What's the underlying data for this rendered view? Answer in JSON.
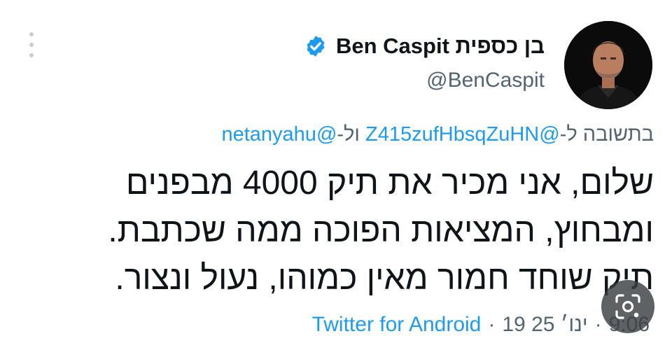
{
  "author": {
    "display_name": "Ben Caspit בן כספית",
    "handle": "@BenCaspit",
    "verified": true
  },
  "reply": {
    "prefix": "בתשובה ל-",
    "mention1": "@Z415zufHbsqZuHN",
    "joiner": " ול-",
    "mention2": "@netanyahu"
  },
  "tweet": {
    "lines": [
      "שלום, אני מכיר את תיק 4000 מבפנים",
      "ומבחוץ, המציאות הפוכה ממה שכתבת.",
      "תיק שוחד חמור מאין כמוהו, נעול ונצור."
    ]
  },
  "meta": {
    "source": "Twitter for Android",
    "date": "19 ינו׳ 25",
    "time": "9:06",
    "separator": "·"
  },
  "icons": {
    "menu": "more-vertical-icon",
    "verified": "verified-badge-icon",
    "lens": "google-lens-icon"
  },
  "colors": {
    "accent": "#1d9bf0",
    "text": "#0f1419",
    "secondary": "#536471"
  }
}
